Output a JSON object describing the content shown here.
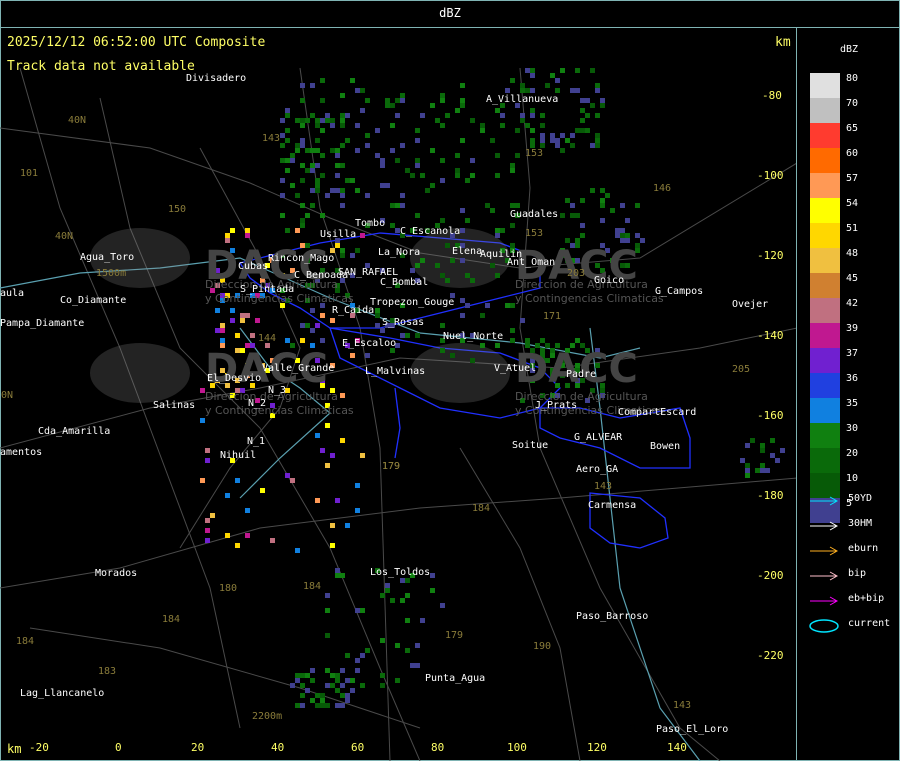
{
  "window": {
    "title": "dBZ"
  },
  "map": {
    "header_left": "2025/12/12 06:52:00 UTC Composite",
    "header_right_unit": "km",
    "status_message": "Track data not available",
    "x_unit": "km",
    "x_ticks": [
      "-20",
      "0",
      "20",
      "40",
      "60",
      "80",
      "100",
      "120",
      "140"
    ],
    "y_ticks": [
      "-80",
      "-100",
      "-120",
      "-140",
      "-160",
      "-180",
      "-200",
      "-220"
    ],
    "towns": [
      {
        "name": "Divisadero"
      },
      {
        "name": "A_Villanueva"
      },
      {
        "name": "Guadales"
      },
      {
        "name": "Usilla"
      },
      {
        "name": "Tombo"
      },
      {
        "name": "C_Escanola"
      },
      {
        "name": "Elena"
      },
      {
        "name": "Aquilin"
      },
      {
        "name": "Ant_Oman"
      },
      {
        "name": "La_Nora"
      },
      {
        "name": "SAN_RAFAEL"
      },
      {
        "name": "C_Benoada"
      },
      {
        "name": "C_Bombal"
      },
      {
        "name": "Cubas"
      },
      {
        "name": "S_Pintada"
      },
      {
        "name": "Rincon_Mago"
      },
      {
        "name": "Tropezon_Gouge"
      },
      {
        "name": "R_Caida"
      },
      {
        "name": "S_Rosas"
      },
      {
        "name": "Nuel_Norte"
      },
      {
        "name": "E_Escaloo"
      },
      {
        "name": "Valle_Grande"
      },
      {
        "name": "L_Malvinas"
      },
      {
        "name": "El_Desvio"
      },
      {
        "name": "N_3"
      },
      {
        "name": "N_2"
      },
      {
        "name": "N_1"
      },
      {
        "name": "Nihuil"
      },
      {
        "name": "Salinas"
      },
      {
        "name": "Cda_Amarilla"
      },
      {
        "name": "amentos"
      },
      {
        "name": "aula"
      },
      {
        "name": "Pampa_Diamante"
      },
      {
        "name": "Agua_Toro"
      },
      {
        "name": "Co_Diamante"
      },
      {
        "name": "Goico"
      },
      {
        "name": "G_Campos"
      },
      {
        "name": "Ovejer"
      },
      {
        "name": "V_Atuel"
      },
      {
        "name": "Padre"
      },
      {
        "name": "J_Prats"
      },
      {
        "name": "CompartEscard"
      },
      {
        "name": "G_ALVEAR"
      },
      {
        "name": "Bowen"
      },
      {
        "name": "Soitue"
      },
      {
        "name": "Aero_GA"
      },
      {
        "name": "Carmensa"
      },
      {
        "name": "Los_Toldos"
      },
      {
        "name": "Morados"
      },
      {
        "name": "Paso_Barroso"
      },
      {
        "name": "Punta_Agua"
      },
      {
        "name": "Lag_Llancanelo"
      },
      {
        "name": "Paso_El_Loro"
      }
    ],
    "roads": [
      {
        "label": "143"
      },
      {
        "label": "101"
      },
      {
        "label": "40N"
      },
      {
        "label": "150"
      },
      {
        "label": "40N"
      },
      {
        "label": "153"
      },
      {
        "label": "146"
      },
      {
        "label": "153"
      },
      {
        "label": "203"
      },
      {
        "label": "171"
      },
      {
        "label": "144"
      },
      {
        "label": "205"
      },
      {
        "label": "143"
      },
      {
        "label": "184"
      },
      {
        "label": "179"
      },
      {
        "label": "180"
      },
      {
        "label": "184"
      },
      {
        "label": "184"
      },
      {
        "label": "179"
      },
      {
        "label": "190"
      },
      {
        "label": "183"
      },
      {
        "label": "184"
      },
      {
        "label": "143"
      },
      {
        "label": "1500m"
      },
      {
        "label": "2200m"
      },
      {
        "label": "179"
      },
      {
        "label": "0N"
      }
    ],
    "watermark": {
      "brand": "DACC",
      "line1": "Direccion de Agricultura",
      "line2": "y Contingencias Climaticas"
    }
  },
  "legend": {
    "title": "dBZ",
    "scale": [
      {
        "value": "80",
        "color": "#e0e0e0"
      },
      {
        "value": "70",
        "color": "#c0c0c0"
      },
      {
        "value": "65",
        "color": "#ff3b2f"
      },
      {
        "value": "60",
        "color": "#ff6a00"
      },
      {
        "value": "57",
        "color": "#ff9955"
      },
      {
        "value": "54",
        "color": "#ffff00"
      },
      {
        "value": "51",
        "color": "#ffd700"
      },
      {
        "value": "48",
        "color": "#f0c040"
      },
      {
        "value": "45",
        "color": "#d08030"
      },
      {
        "value": "42",
        "color": "#c07080"
      },
      {
        "value": "39",
        "color": "#c01890"
      },
      {
        "value": "37",
        "color": "#7020d0"
      },
      {
        "value": "36",
        "color": "#2040e0"
      },
      {
        "value": "35",
        "color": "#1080e0"
      },
      {
        "value": "30",
        "color": "#108010"
      },
      {
        "value": "20",
        "color": "#0a6a0a"
      },
      {
        "value": "10",
        "color": "#075a07"
      },
      {
        "value": "5",
        "color": "#404090"
      }
    ],
    "tracks": [
      {
        "label": "50YD",
        "color": "#00e5ff"
      },
      {
        "label": "30HM",
        "color": "#ffffff"
      },
      {
        "label": "eburn",
        "color": "#ffb020"
      },
      {
        "label": "bip",
        "color": "#ffc0cb"
      },
      {
        "label": "eb+bip",
        "color": "#ff00ff"
      },
      {
        "label": "current",
        "color": "#00e5ff"
      }
    ]
  }
}
